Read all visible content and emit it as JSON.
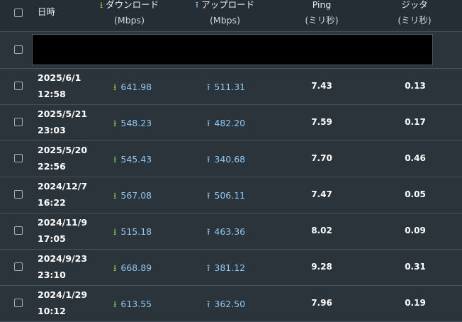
{
  "header": {
    "date": "日時",
    "download": "ダウンロード",
    "download_unit": "(Mbps)",
    "upload": "アップロード",
    "upload_unit": "(Mbps)",
    "ping": "Ping",
    "ping_unit": "(ミリ秒)",
    "jitter": "ジッタ",
    "jitter_unit": "(ミリ秒)"
  },
  "icons": {
    "download": "download-arrow-icon",
    "upload": "upload-arrow-icon"
  },
  "colors": {
    "download_icon": "#8cc63f",
    "upload_icon": "#7fb8e8",
    "value_text": "#8fc8f4"
  },
  "filter": {
    "value": ""
  },
  "rows": [
    {
      "date": "2025/6/1",
      "time": "12:58",
      "download": "641.98",
      "upload": "511.31",
      "ping": "7.43",
      "jitter": "0.13"
    },
    {
      "date": "2025/5/21",
      "time": "23:03",
      "download": "548.23",
      "upload": "482.20",
      "ping": "7.59",
      "jitter": "0.17"
    },
    {
      "date": "2025/5/20",
      "time": "22:56",
      "download": "545.43",
      "upload": "340.68",
      "ping": "7.70",
      "jitter": "0.46"
    },
    {
      "date": "2024/12/7",
      "time": "16:22",
      "download": "567.08",
      "upload": "506.11",
      "ping": "7.47",
      "jitter": "0.05"
    },
    {
      "date": "2024/11/9",
      "time": "17:05",
      "download": "515.18",
      "upload": "463.36",
      "ping": "8.02",
      "jitter": "0.09"
    },
    {
      "date": "2024/9/23",
      "time": "23:10",
      "download": "668.89",
      "upload": "381.12",
      "ping": "9.28",
      "jitter": "0.31"
    },
    {
      "date": "2024/1/29",
      "time": "10:12",
      "download": "613.55",
      "upload": "362.50",
      "ping": "7.96",
      "jitter": "0.19"
    }
  ]
}
